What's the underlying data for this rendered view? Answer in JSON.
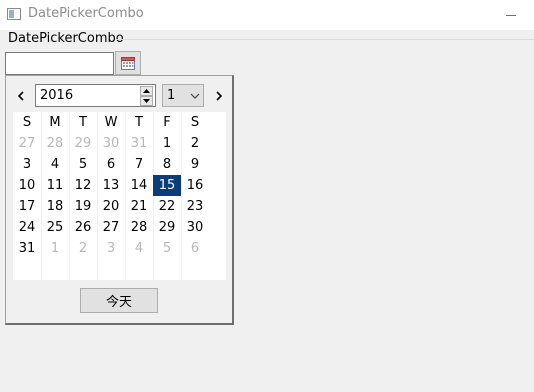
{
  "window": {
    "title": "DatePickerCombo"
  },
  "widget": {
    "label": "DatePickerCombo",
    "input_value": ""
  },
  "calendar": {
    "year": "2016",
    "month": "1",
    "weekdays": [
      "S",
      "M",
      "T",
      "W",
      "T",
      "F",
      "S"
    ],
    "weeks": [
      [
        {
          "d": "27",
          "o": true
        },
        {
          "d": "28",
          "o": true
        },
        {
          "d": "29",
          "o": true
        },
        {
          "d": "30",
          "o": true
        },
        {
          "d": "31",
          "o": true
        },
        {
          "d": "1"
        },
        {
          "d": "2"
        }
      ],
      [
        {
          "d": "3"
        },
        {
          "d": "4"
        },
        {
          "d": "5"
        },
        {
          "d": "6"
        },
        {
          "d": "7"
        },
        {
          "d": "8"
        },
        {
          "d": "9"
        }
      ],
      [
        {
          "d": "10"
        },
        {
          "d": "11"
        },
        {
          "d": "12"
        },
        {
          "d": "13"
        },
        {
          "d": "14"
        },
        {
          "d": "15",
          "s": true
        },
        {
          "d": "16"
        }
      ],
      [
        {
          "d": "17"
        },
        {
          "d": "18"
        },
        {
          "d": "19"
        },
        {
          "d": "20"
        },
        {
          "d": "21"
        },
        {
          "d": "22"
        },
        {
          "d": "23"
        }
      ],
      [
        {
          "d": "24"
        },
        {
          "d": "25"
        },
        {
          "d": "26"
        },
        {
          "d": "27"
        },
        {
          "d": "28"
        },
        {
          "d": "29"
        },
        {
          "d": "30"
        }
      ],
      [
        {
          "d": "31"
        },
        {
          "d": "1",
          "o": true
        },
        {
          "d": "2",
          "o": true
        },
        {
          "d": "3",
          "o": true
        },
        {
          "d": "4",
          "o": true
        },
        {
          "d": "5",
          "o": true
        },
        {
          "d": "6",
          "o": true
        }
      ]
    ],
    "today_label": "今天"
  },
  "colors": {
    "selected_bg": "#0a3d7a",
    "other_month_text": "#b8b8b8"
  },
  "icons": {
    "app": "window-icon",
    "calendar_button": "calendar-icon",
    "prev": "chevron-left-icon",
    "next": "chevron-right-icon",
    "month_dropdown": "chevron-down-icon"
  }
}
